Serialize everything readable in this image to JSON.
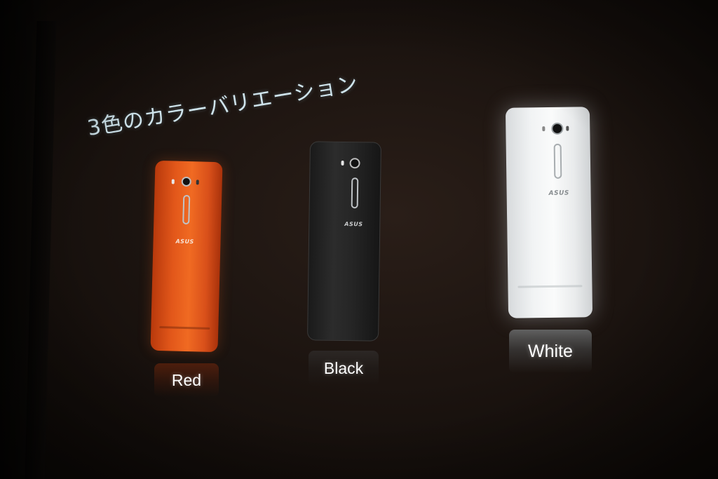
{
  "slide": {
    "title": "3色のカラーバリエーション"
  },
  "phones": [
    {
      "color_name": "Red",
      "color": "#e2571a",
      "brand": "ASUS"
    },
    {
      "color_name": "Black",
      "color": "#262626",
      "brand": "ASUS"
    },
    {
      "color_name": "White",
      "color": "#f1f3f4",
      "brand": "ASUS"
    }
  ]
}
